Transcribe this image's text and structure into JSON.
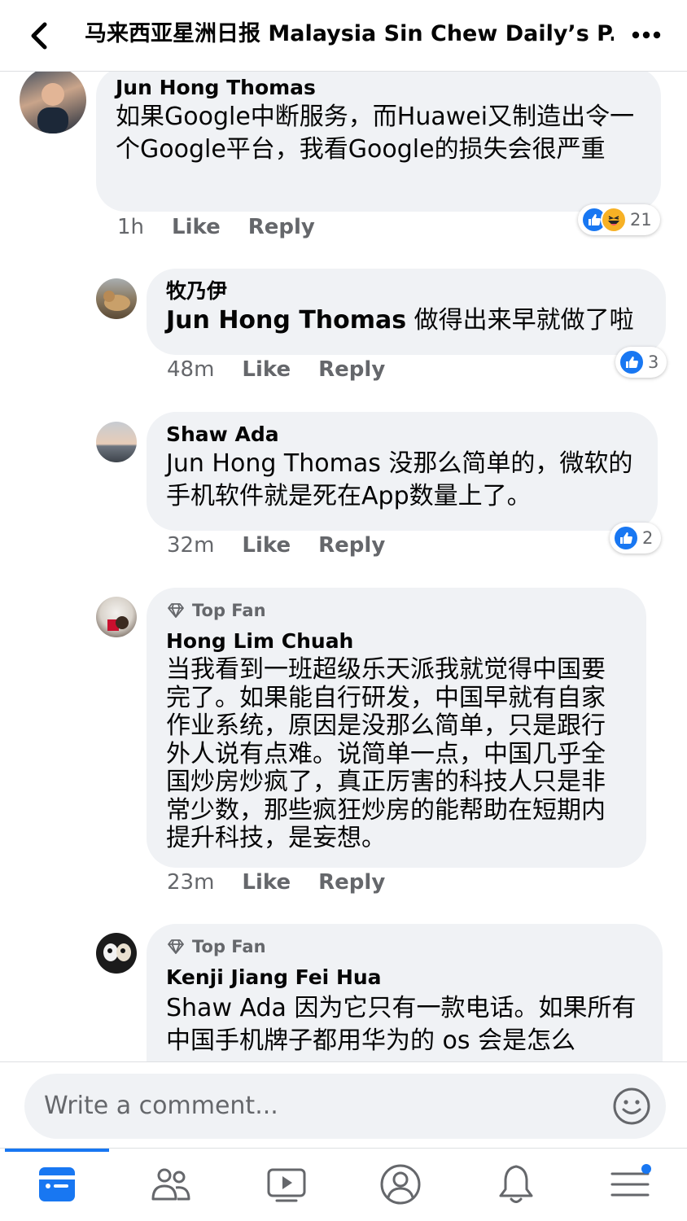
{
  "header": {
    "title": "马来西亚星洲日报 Malaysia Sin Chew Daily’s P...",
    "back_icon": "chevron-left-icon",
    "more_icon": "ellipsis-icon"
  },
  "comments": [
    {
      "author": "Jun Hong Thomas",
      "text": "如果Google中断服务，而Huawei又制造出令一个Google平台，我看Google的损失会很严重",
      "time": "1h",
      "like_label": "Like",
      "reply_label": "Reply",
      "reactions": [
        "like",
        "haha"
      ],
      "reaction_count": "21"
    },
    {
      "author": "牧乃伊",
      "mention": "Jun Hong Thomas",
      "text": "做得出来早就做了啦",
      "time": "48m",
      "like_label": "Like",
      "reply_label": "Reply",
      "reactions": [
        "like"
      ],
      "reaction_count": "3"
    },
    {
      "author": "Shaw Ada",
      "mention": "Jun Hong Thomas",
      "text": "没那么简单的，微软的手机软件就是死在App数量上了。",
      "time": "32m",
      "like_label": "Like",
      "reply_label": "Reply",
      "reactions": [
        "like"
      ],
      "reaction_count": "2"
    },
    {
      "badge": "Top Fan",
      "author": "Hong Lim Chuah",
      "text": "当我看到一班超级乐天派我就觉得中国要完了。如果能自行研发，中国早就有自家作业系统，原因是没那么简单，只是跟行外人说有点难。说简单一点，中国几乎全国炒房炒疯了，真正厉害的科技人只是非常少数，那些疯狂炒房的能帮助在短期内提升科技，是妄想。",
      "time": "23m",
      "like_label": "Like",
      "reply_label": "Reply"
    },
    {
      "badge": "Top Fan",
      "author": "Kenji Jiang Fei Hua",
      "mention": "Shaw Ada",
      "text": "因为它只有一款电话。如果所有中国手机牌子都用华为的 os 会是怎么"
    }
  ],
  "composer": {
    "placeholder": "Write a comment...",
    "emoji_icon": "smiley-icon"
  },
  "tabbar": {
    "tabs": [
      "news-feed-icon",
      "friends-icon",
      "watch-icon",
      "profile-icon",
      "notifications-icon",
      "menu-icon"
    ],
    "active": "news-feed-icon",
    "colors": {
      "accent": "#1877f2",
      "inactive": "#65676b"
    }
  }
}
